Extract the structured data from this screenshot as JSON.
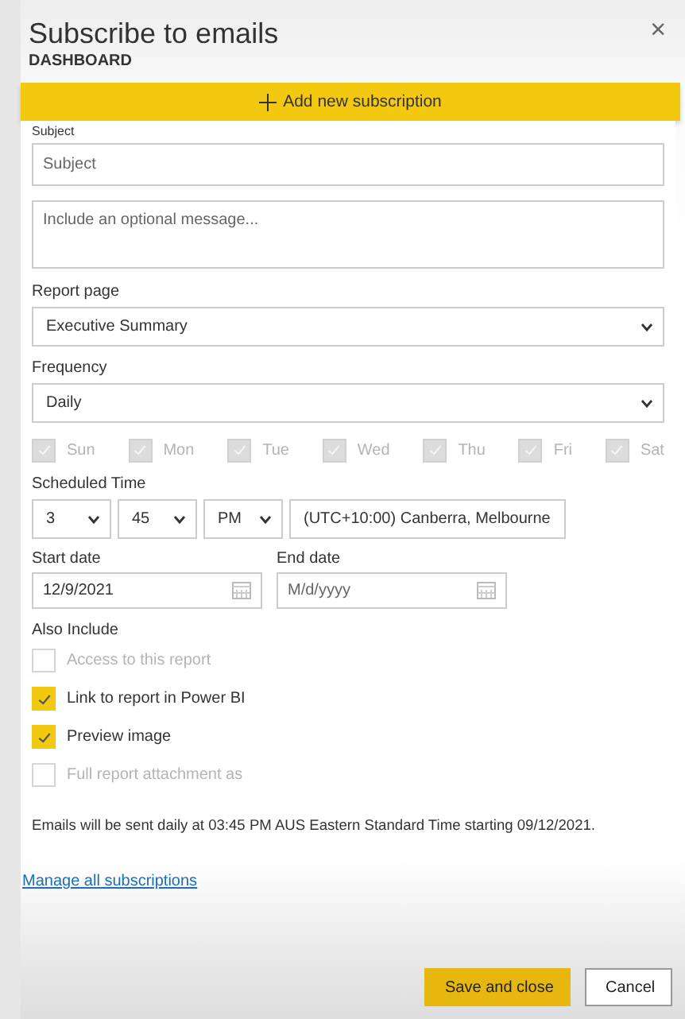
{
  "dialog": {
    "title": "Subscribe to emails",
    "subtitle": "DASHBOARD",
    "close": "×"
  },
  "add_button": {
    "label": "Add new subscription"
  },
  "subject": {
    "label": "Subject",
    "placeholder": "Subject"
  },
  "message": {
    "placeholder": "Include an optional message..."
  },
  "report_page": {
    "label": "Report page",
    "value": "Executive Summary"
  },
  "frequency": {
    "label": "Frequency",
    "value": "Daily"
  },
  "days": [
    {
      "label": "Sun",
      "checked": true,
      "disabled": true
    },
    {
      "label": "Mon",
      "checked": true,
      "disabled": true
    },
    {
      "label": "Tue",
      "checked": true,
      "disabled": true
    },
    {
      "label": "Wed",
      "checked": true,
      "disabled": true
    },
    {
      "label": "Thu",
      "checked": true,
      "disabled": true
    },
    {
      "label": "Fri",
      "checked": true,
      "disabled": true
    },
    {
      "label": "Sat",
      "checked": true,
      "disabled": true
    }
  ],
  "scheduled_time": {
    "label": "Scheduled Time",
    "hour": "3",
    "minute": "45",
    "period": "PM",
    "timezone": "(UTC+10:00) Canberra, Melbourne"
  },
  "start_date": {
    "label": "Start date",
    "value": "12/9/2021"
  },
  "end_date": {
    "label": "End date",
    "placeholder": "M/d/yyyy"
  },
  "also_include": {
    "label": "Also Include",
    "options": [
      {
        "label": "Access to this report",
        "checked": false,
        "disabled": true
      },
      {
        "label": "Link to report in Power BI",
        "checked": true,
        "disabled": false
      },
      {
        "label": "Preview image",
        "checked": true,
        "disabled": false
      },
      {
        "label": "Full report attachment as",
        "checked": false,
        "disabled": true
      }
    ]
  },
  "summary": "Emails will be sent daily at 03:45 PM AUS Eastern Standard Time starting 09/12/2021.",
  "manage_link": "Manage all subscriptions",
  "buttons": [
    {
      "label": "Save and close",
      "kind": "primary"
    },
    {
      "label": "Cancel",
      "kind": "secondary"
    }
  ]
}
